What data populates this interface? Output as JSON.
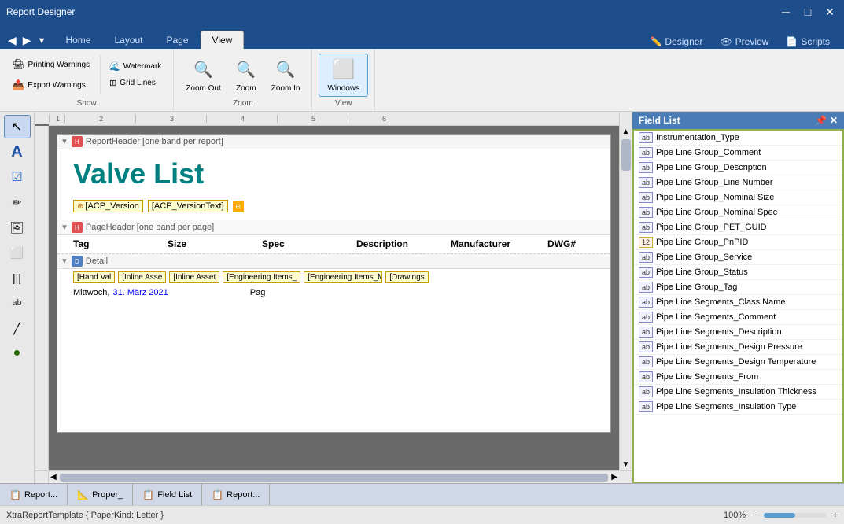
{
  "titleBar": {
    "title": "Report Designer",
    "minimize": "─",
    "restore": "□",
    "close": "✕"
  },
  "ribbonTabs": {
    "tabs": [
      "Home",
      "Layout",
      "Page",
      "View"
    ],
    "activeTab": "View",
    "rightButtons": [
      "Designer",
      "Preview",
      "Scripts"
    ]
  },
  "ribbon": {
    "groups": {
      "show": {
        "label": "Show",
        "watermark": "Watermark",
        "gridLines": "Grid Lines",
        "printingWarnings": "Printing Warnings",
        "exportWarnings": "Export Warnings"
      },
      "zoom": {
        "label": "Zoom",
        "zoomOut": "Zoom Out",
        "zoom": "Zoom",
        "zoomIn": "Zoom In"
      },
      "view": {
        "label": "View",
        "windows": "Windows"
      }
    }
  },
  "fieldList": {
    "title": "Field List",
    "pin": "📌",
    "close": "✕",
    "items": [
      {
        "type": "ab",
        "name": "Instrumentation_Type"
      },
      {
        "type": "ab",
        "name": "Pipe Line Group_Comment"
      },
      {
        "type": "ab",
        "name": "Pipe Line Group_Description"
      },
      {
        "type": "ab",
        "name": "Pipe Line Group_Line Number"
      },
      {
        "type": "ab",
        "name": "Pipe Line Group_Nominal Size"
      },
      {
        "type": "ab",
        "name": "Pipe Line Group_Nominal Spec"
      },
      {
        "type": "ab",
        "name": "Pipe Line Group_PET_GUID"
      },
      {
        "type": "12",
        "name": "Pipe Line Group_PnPID"
      },
      {
        "type": "ab",
        "name": "Pipe Line Group_Service"
      },
      {
        "type": "ab",
        "name": "Pipe Line Group_Status"
      },
      {
        "type": "ab",
        "name": "Pipe Line Group_Tag"
      },
      {
        "type": "ab",
        "name": "Pipe Line Segments_Class Name"
      },
      {
        "type": "ab",
        "name": "Pipe Line Segments_Comment"
      },
      {
        "type": "ab",
        "name": "Pipe Line Segments_Description"
      },
      {
        "type": "ab",
        "name": "Pipe Line Segments_Design Pressure"
      },
      {
        "type": "ab",
        "name": "Pipe Line Segments_Design Temperature"
      },
      {
        "type": "ab",
        "name": "Pipe Line Segments_From"
      },
      {
        "type": "ab",
        "name": "Pipe Line Segments_Insulation Thickness"
      },
      {
        "type": "ab",
        "name": "Pipe Line Segments_Insulation Type"
      }
    ]
  },
  "canvas": {
    "reportHeaderBand": "ReportHeader [one band per report]",
    "reportTitle": "Valve List",
    "acpVersionField": "[ACP_Version",
    "acpVersionTextField": "[ACP_VersionText]",
    "pageHeaderBand": "PageHeader [one band per page]",
    "columns": [
      "Tag",
      "Size",
      "Spec",
      "Description",
      "Manufacturer",
      "DWG#"
    ],
    "detailBand": "Detail",
    "detailFields": [
      "[Hand Val",
      "[Inline Asse",
      "[Inline Asset",
      "[Engineering Items_",
      "[Engineering Items_M",
      "[Drawings"
    ],
    "dateText": "Mittwoch,",
    "dateHighlight": "31. März 2021",
    "dateSuffix": "Pag"
  },
  "bottomTabs": [
    {
      "icon": "📋",
      "label": "Report..."
    },
    {
      "icon": "📐",
      "label": "Proper_"
    },
    {
      "icon": "📋",
      "label": "Field List"
    },
    {
      "icon": "📋",
      "label": "Report..."
    }
  ],
  "statusBar": {
    "template": "XtraReportTemplate { PaperKind: Letter }",
    "zoom": "100%",
    "zoomMinus": "−",
    "zoomPlus": "+"
  },
  "rulers": {
    "marks": [
      "1",
      "2",
      "3",
      "4",
      "5",
      "6"
    ]
  }
}
